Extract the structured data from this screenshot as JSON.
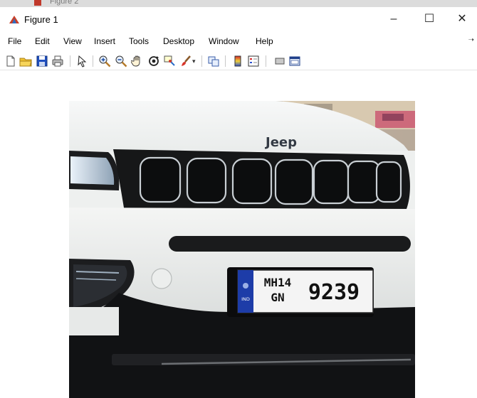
{
  "background_window": {
    "title": "Figure 2"
  },
  "window": {
    "title": "Figure 1"
  },
  "window_controls": {
    "minimize": "–",
    "maximize": "☐",
    "close": "✕"
  },
  "menu": {
    "items": [
      "File",
      "Edit",
      "View",
      "Insert",
      "Tools",
      "Desktop",
      "Window",
      "Help"
    ]
  },
  "toolbar": {
    "buttons": [
      "new-figure-icon",
      "open-file-icon",
      "save-icon",
      "print-icon",
      "edit-plot-arrow-icon",
      "zoom-in-icon",
      "zoom-out-icon",
      "pan-hand-icon",
      "rotate-3d-icon",
      "data-cursor-icon",
      "brush-icon",
      "link-plot-icon",
      "insert-colorbar-icon",
      "insert-legend-icon",
      "hide-plot-tools-icon",
      "show-plot-tools-icon"
    ]
  },
  "image": {
    "brand_badge": "Jeep",
    "plate": {
      "country": "IND",
      "line1": "MH14",
      "line2": "GN",
      "number": "9239"
    }
  },
  "colors": {
    "car_body": "#eef0ef",
    "grille": "#161718",
    "plate_background": "#f4f4f4",
    "plate_strip": "#1d3ca8",
    "matlab_icon": "#c8402a"
  }
}
